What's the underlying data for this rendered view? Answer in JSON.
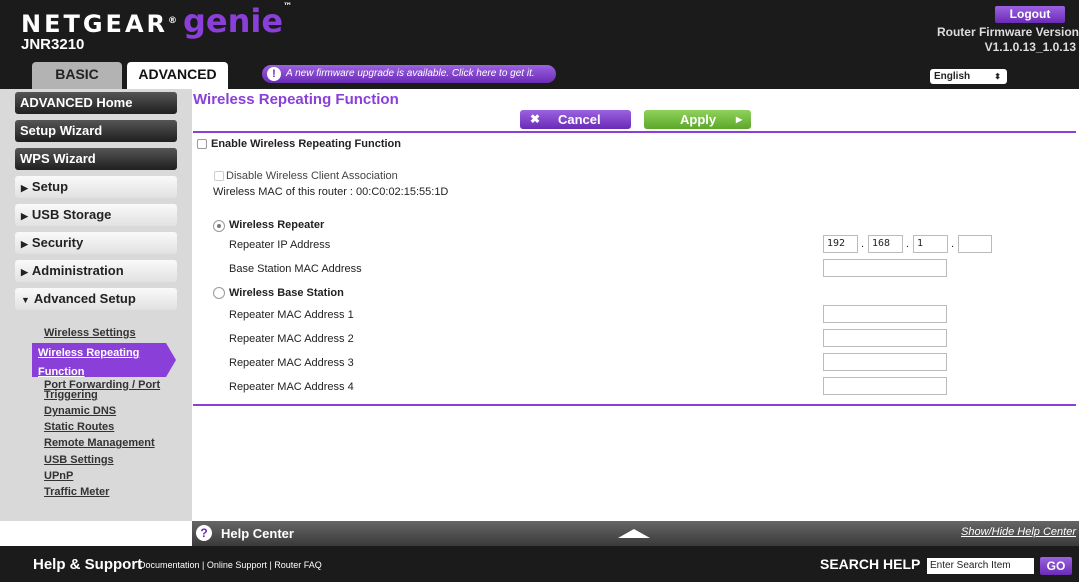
{
  "header": {
    "brand": "NETGEAR",
    "brand_mark": "®",
    "product": "genie",
    "trademark": "™",
    "model": "JNR3210",
    "logout_label": "Logout",
    "firmware_label": "Router Firmware Version",
    "firmware_version": "V1.1.0.13_1.0.13",
    "firmware_notice": "A new firmware upgrade is available. Click here to get it.",
    "language": "English"
  },
  "tabs": [
    {
      "label": "BASIC",
      "active": false
    },
    {
      "label": "ADVANCED",
      "active": true
    }
  ],
  "sidebar": {
    "main_items": [
      "ADVANCED Home",
      "Setup Wizard",
      "WPS Wizard"
    ],
    "sub_items": [
      "Setup",
      "USB Storage",
      "Security",
      "Administration",
      "Advanced Setup"
    ],
    "links": [
      "Wireless Settings",
      "Wireless Repeating Function",
      "Port Forwarding / Port Triggering",
      "Dynamic DNS",
      "Static Routes",
      "Remote Management",
      "USB Settings",
      "UPnP",
      "Traffic Meter"
    ],
    "active_link_lines": [
      "Wireless Repeating",
      "Function"
    ],
    "link_port_lines": [
      "Port Forwarding / Port",
      "Triggering"
    ]
  },
  "content": {
    "title": "Wireless Repeating Function",
    "cancel_label": "Cancel",
    "apply_label": "Apply",
    "enable_label": "Enable Wireless Repeating Function",
    "enable_checked": false,
    "disable_client_label": "Disable Wireless Client Association",
    "disable_client_checked": false,
    "mac_label": "Wireless MAC of this router : 00:C0:02:15:55:1D",
    "repeater_label": "Wireless Repeater",
    "repeater_selected": true,
    "repeater_ip_label": "Repeater IP Address",
    "repeater_ip": [
      "192",
      "168",
      "1",
      ""
    ],
    "base_mac_label": "Base Station MAC Address",
    "base_mac_value": "",
    "base_station_label": "Wireless Base Station",
    "base_station_selected": false,
    "repeater_macs": [
      {
        "label": "Repeater MAC Address 1",
        "value": ""
      },
      {
        "label": "Repeater MAC Address 2",
        "value": ""
      },
      {
        "label": "Repeater MAC Address 3",
        "value": ""
      },
      {
        "label": "Repeater MAC Address 4",
        "value": ""
      }
    ]
  },
  "help_center": {
    "title": "Help Center",
    "toggle_label": "Show/Hide Help Center"
  },
  "footer": {
    "title": "Help & Support",
    "links": [
      "Documentation",
      "Online Support",
      "Router FAQ"
    ],
    "search_label": "SEARCH HELP",
    "search_value": "Enter Search Item",
    "go_label": "GO"
  },
  "colors": {
    "accent_purple": "#8a3fd8",
    "apply_green": "#6cb83a",
    "header_bg": "#1b1b1b",
    "sidebar_bg": "#d9d9d9"
  }
}
